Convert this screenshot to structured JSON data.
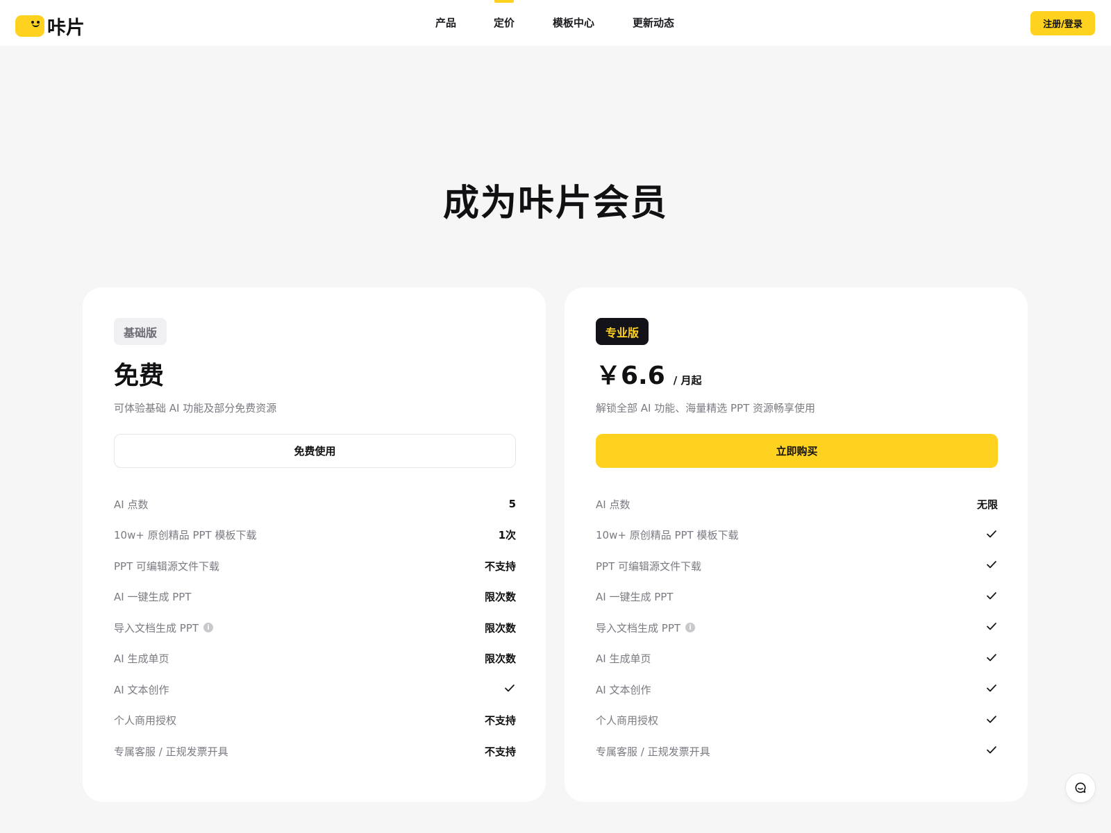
{
  "brand": {
    "name": "咔片",
    "accent": "#ffd21f"
  },
  "nav": {
    "items": [
      {
        "label": "产品"
      },
      {
        "label": "定价",
        "active": true
      },
      {
        "label": "模板中心"
      },
      {
        "label": "更新动态"
      }
    ],
    "login_label": "注册/登录"
  },
  "page_title": "成为咔片会员",
  "plans": {
    "basic": {
      "badge": "基础版",
      "price": "免费",
      "description": "可体验基础 AI 功能及部分免费资源",
      "button": "免费使用",
      "features": [
        {
          "label": "AI 点数",
          "value": "5"
        },
        {
          "label": "10w+ 原创精品 PPT 模板下载",
          "value": "1次"
        },
        {
          "label": "PPT 可编辑源文件下载",
          "value": "不支持"
        },
        {
          "label": "AI 一键生成 PPT",
          "value": "限次数"
        },
        {
          "label": "导入文档生成 PPT",
          "value": "限次数",
          "info": true
        },
        {
          "label": "AI 生成单页",
          "value": "限次数"
        },
        {
          "label": "AI 文本创作",
          "value": "",
          "check": true
        },
        {
          "label": "个人商用授权",
          "value": "不支持"
        },
        {
          "label": "专属客服 / 正规发票开具",
          "value": "不支持"
        }
      ]
    },
    "pro": {
      "badge": "专业版",
      "price": "￥6.6",
      "price_unit": "/ 月起",
      "description": "解锁全部 AI 功能、海量精选 PPT 资源畅享使用",
      "button": "立即购买",
      "features": [
        {
          "label": "AI 点数",
          "value": "无限"
        },
        {
          "label": "10w+ 原创精品 PPT 模板下载",
          "value": "",
          "check": true
        },
        {
          "label": "PPT 可编辑源文件下载",
          "value": "",
          "check": true
        },
        {
          "label": "AI 一键生成 PPT",
          "value": "",
          "check": true
        },
        {
          "label": "导入文档生成 PPT",
          "value": "",
          "check": true,
          "info": true
        },
        {
          "label": "AI 生成单页",
          "value": "",
          "check": true
        },
        {
          "label": "AI 文本创作",
          "value": "",
          "check": true
        },
        {
          "label": "个人商用授权",
          "value": "",
          "check": true
        },
        {
          "label": "专属客服 / 正规发票开具",
          "value": "",
          "check": true
        }
      ]
    }
  },
  "icons": {
    "info": "i",
    "check": "check-icon",
    "chat": "chat-bubble-icon"
  }
}
